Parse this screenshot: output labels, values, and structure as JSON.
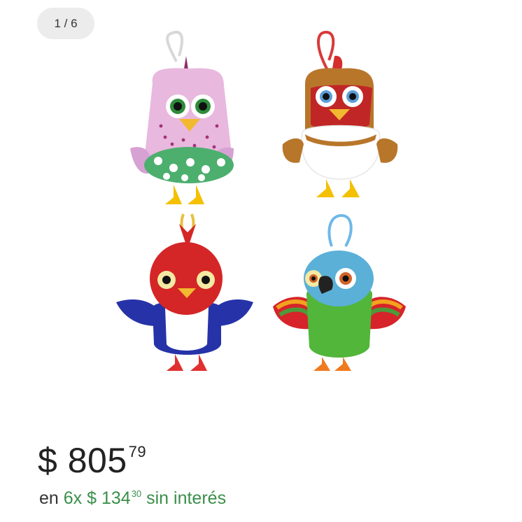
{
  "gallery": {
    "counter": "1 / 6",
    "image_alt": "Set of four plush bird keychains: pink hen, brown rooster, red bird, green parrot"
  },
  "product": {
    "currency": "$",
    "price_integer": "805",
    "price_cents": "79",
    "installments_prefix": "en",
    "installments_count": "6x",
    "installments_currency": "$",
    "installments_integer": "134",
    "installments_cents": "30",
    "installments_suffix": "sin interés"
  },
  "colors": {
    "accent_green": "#3a8f4a"
  }
}
